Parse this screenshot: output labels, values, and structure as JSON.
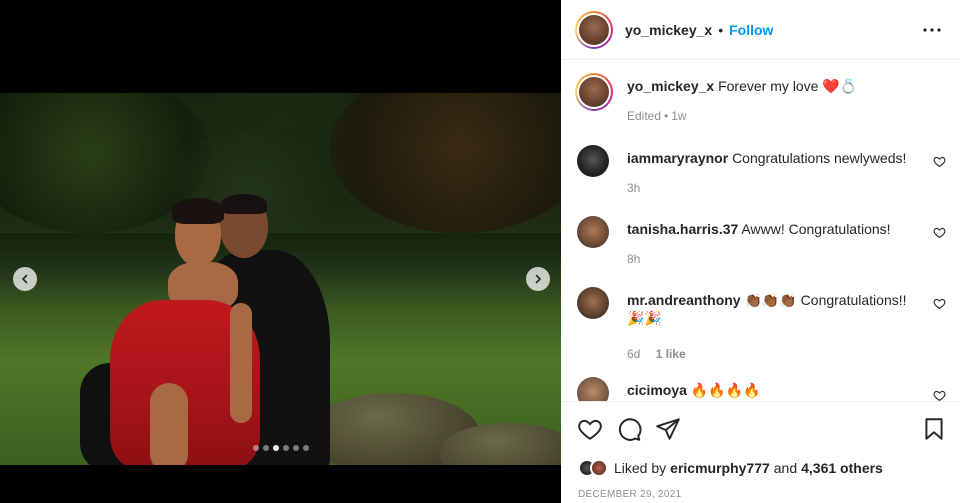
{
  "post": {
    "author": "yo_mickey_x",
    "separator": "•",
    "follow_label": "Follow",
    "caption_text": "Forever my love",
    "caption_emoji": "❤️💍",
    "caption_meta_edited": "Edited",
    "caption_meta_dot": "•",
    "caption_meta_time": "1w",
    "slide_count": 6,
    "active_slide": 3
  },
  "comments": [
    {
      "user": "iammaryraynor",
      "text": "Congratulations newlyweds!",
      "time": "3h",
      "likes": ""
    },
    {
      "user": "tanisha.harris.37",
      "text": "Awww! Congratulations!",
      "time": "8h",
      "likes": ""
    },
    {
      "user": "mr.andreanthony",
      "text": "👏🏾👏🏾👏🏾 Congratulations!! 🎉🎉",
      "time": "6d",
      "likes": "1 like"
    },
    {
      "user": "cicimoya",
      "text": "🔥🔥🔥🔥",
      "time": "",
      "likes": ""
    }
  ],
  "likes": {
    "prefix": "Liked by",
    "user": "ericmurphy777",
    "and": "and",
    "others": "4,361 others"
  },
  "date": "DECEMBER 29, 2021",
  "colors": {
    "accent": "#0095f6",
    "meta": "#8e8e8e",
    "text": "#262626"
  },
  "icons": [
    "prev-arrow-icon",
    "next-arrow-icon",
    "more-options-icon",
    "heart-icon",
    "comment-icon",
    "share-icon",
    "bookmark-icon"
  ]
}
